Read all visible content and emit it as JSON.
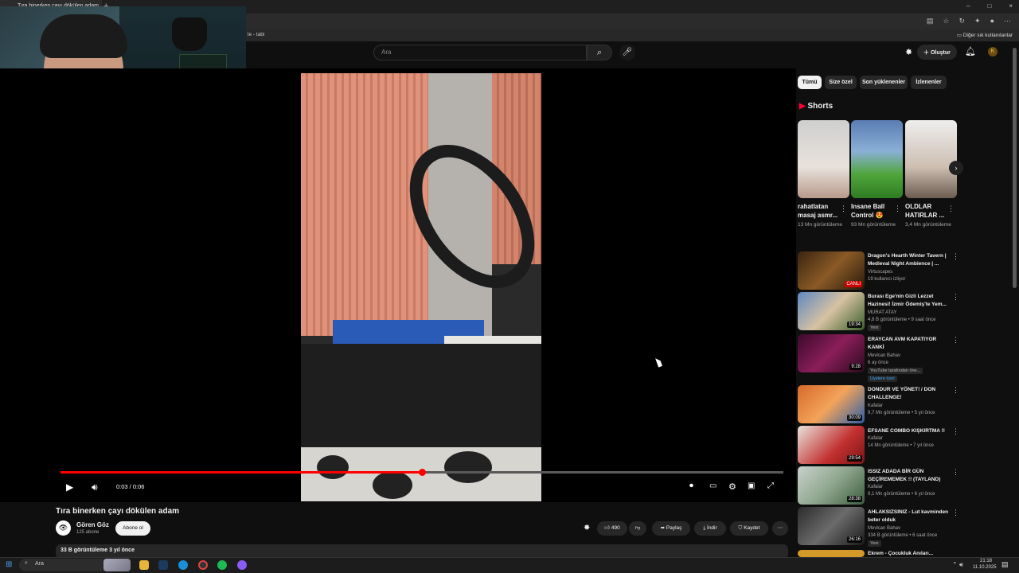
{
  "browser": {
    "tab_title": "Tıra binerken çayı dökülen adam",
    "tab_suffix": "le - tabi",
    "bookmarks_other": "Diğer sık kullanılanlar",
    "window_buttons": [
      "–",
      "□",
      "×"
    ]
  },
  "header": {
    "search_placeholder": "Ara",
    "create_label": "Oluştur",
    "avatar_initial": "K",
    "icons": [
      "search-icon",
      "mic-icon",
      "create-icon",
      "bell-icon"
    ]
  },
  "player": {
    "current_time": "0:03",
    "duration": "0:06",
    "time_display": "0:03 / 0:06",
    "progress": 0.5,
    "accent": "#ff0000"
  },
  "video": {
    "title": "Tıra binerken çayı dökülen adam",
    "channel": "Gören Göz",
    "subscribers": "125 abone",
    "subscribe_label": "Abone ol",
    "likes": "490",
    "share_label": "Paylaş",
    "download_label": "İndir",
    "save_label": "Kaydet",
    "description_line": "33 B görüntüleme  3 yıl önce"
  },
  "sidebar": {
    "chips": [
      "Tümü",
      "Size özel",
      "Son yüklenenler",
      "İzlenenler"
    ],
    "shorts_heading": "Shorts",
    "shorts": [
      {
        "title": "rahatlatan masaj asmr...",
        "views": "13 Mn görüntüleme"
      },
      {
        "title": "Insane Ball Control 😍",
        "views": "93 Mn görüntüleme"
      },
      {
        "title": "OLDLAR HATIRLAR ...",
        "views": "3,4 Mn görüntüleme"
      }
    ],
    "recommendations": [
      {
        "title": "Dragon's Hearth Winter Tavern | Medieval Night Ambience | ...",
        "channel": "Virtuscapes",
        "meta": "19 kullanıcı izliyor",
        "duration": "CANLI",
        "badge": ""
      },
      {
        "title": "Burası Ege'nin Gizli Lezzet Hazinesi! İzmir Ödemiş'te Yem...",
        "channel": "MURAT ATAY",
        "meta": "4,8 B görüntüleme • 9 saat önce",
        "duration": "19:34",
        "badge": "Yeni"
      },
      {
        "title": "ERAYCAN AVM KAPATIYOR KANKİ",
        "channel": "Mevlcan Bahav",
        "meta": "6 ay önce",
        "duration": "9:28",
        "badge": "YouTube tarafından öne...",
        "badge2": "Üyelere özel"
      },
      {
        "title": "DONDUR VE YÖNET! / DON CHALLENGE!",
        "channel": "Kafalar",
        "meta": "9,7 Mn görüntüleme • 5 yıl önce",
        "duration": "30:09",
        "badge": ""
      },
      {
        "title": "EFSANE COMBO KIŞKIRTMA !!",
        "channel": "Kafalar",
        "meta": "14 Mn görüntüleme • 7 yıl önce",
        "duration": "29:54",
        "badge": ""
      },
      {
        "title": "ISSIZ ADADA BİR GÜN GEÇİREMEMEK !! (TAYLAND)",
        "channel": "Kafalar",
        "meta": "9,1 Mn görüntüleme • 6 yıl önce",
        "duration": "28:38",
        "badge": ""
      },
      {
        "title": "AHLAKSIZSINIZ - Lut kavminden beter olduk",
        "channel": "Mevlcan Bahav",
        "meta": "334 B görüntüleme • 6 saat önce",
        "duration": "26:16",
        "badge": "Yeni"
      },
      {
        "title": "Ekrem - Çocukluk Anıları...",
        "channel": "",
        "meta": "",
        "duration": "",
        "badge": ""
      }
    ]
  },
  "taskbar": {
    "search_label": "Ara",
    "time": "21:18",
    "date": "11.10.2025"
  }
}
